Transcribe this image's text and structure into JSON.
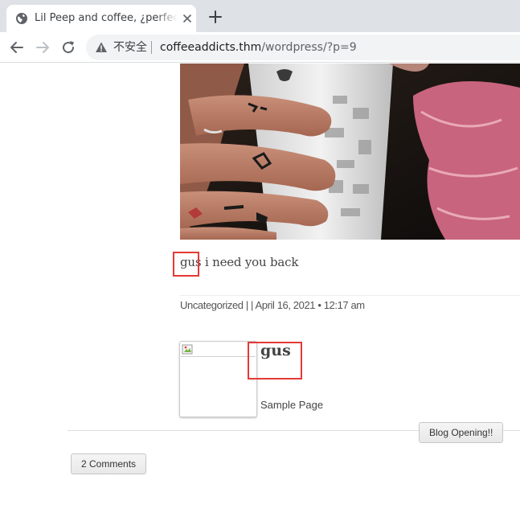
{
  "browser": {
    "tab": {
      "title": "Lil Peep and coffee, ¿perfect combination?",
      "favicon_icon": "globe-icon",
      "close_icon": "close-icon"
    },
    "new_tab_icon": "plus-icon",
    "toolbar": {
      "back_icon": "arrow-left-icon",
      "forward_icon": "arrow-right-icon",
      "reload_icon": "reload-icon",
      "security_icon": "warning-triangle-icon",
      "security_label": "不安全",
      "url_host": "coffeeaddicts.thm",
      "url_path": "/wordpress/?p=9"
    }
  },
  "post": {
    "image_icon": "photo-hand-holding-coffee-cup",
    "text_highlighted": "gus",
    "text_rest": " i need you back",
    "meta": "Uncategorized | | April 16, 2021 • 12:17 am"
  },
  "author": {
    "avatar_icon": "broken-image-icon",
    "name": "gus",
    "link": "Sample Page"
  },
  "navigation": {
    "next_post": "Blog Opening!!"
  },
  "comments": {
    "button_label": "2 Comments"
  },
  "colors": {
    "highlight_box": "#e53935",
    "tabstrip_bg": "#dee1e6",
    "omnibox_bg": "#f1f3f4",
    "text": "#444444"
  }
}
